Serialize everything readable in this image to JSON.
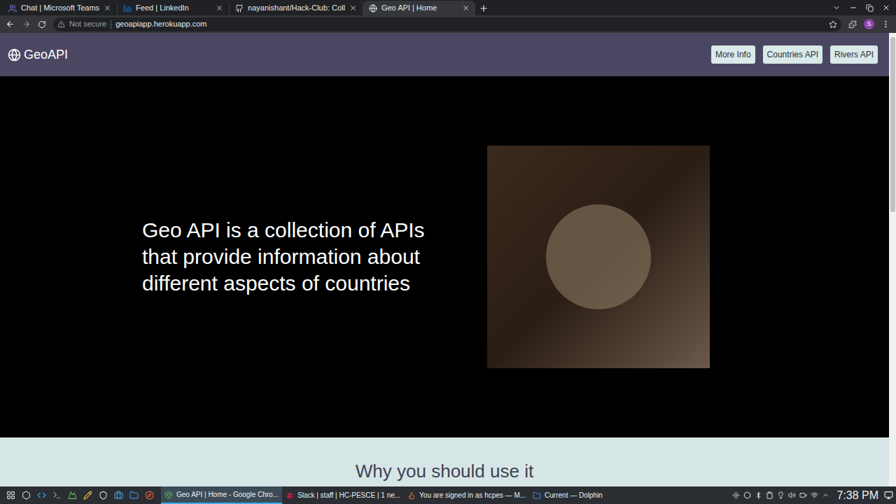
{
  "browser": {
    "tabs": [
      {
        "label": "Chat | Microsoft Teams",
        "selected": false
      },
      {
        "label": "Feed | LinkedIn",
        "selected": false
      },
      {
        "label": "nayanishant/Hack-Club: Coll",
        "selected": false
      },
      {
        "label": "Geo API | Home",
        "selected": true
      }
    ],
    "security": "Not secure",
    "url": "geoapiapp.herokuapp.com",
    "profile": "S"
  },
  "page": {
    "brand": "GeoAPI",
    "nav": [
      "More Info",
      "Countries API",
      "Rivers API"
    ],
    "hero": "Geo API is a collection of APIs that provide information about different aspects of countries",
    "section_heading": "Why you should use it"
  },
  "taskbar": {
    "tasks": [
      {
        "label": "Geo API | Home - Google Chro...",
        "selected": true
      },
      {
        "label": "Slack | staff | HC-PESCE | 1 ne...",
        "selected": false
      },
      {
        "label": "You are signed in as hcpes — M...",
        "selected": false
      },
      {
        "label": "Current — Dolphin",
        "selected": false
      }
    ],
    "clock": "7:38 PM"
  }
}
